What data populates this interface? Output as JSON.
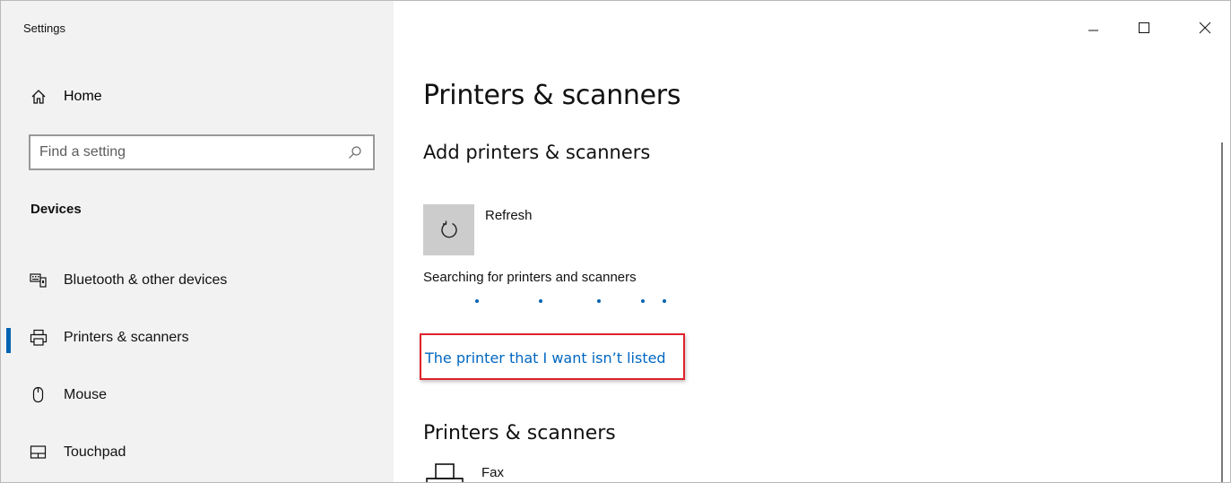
{
  "window": {
    "title": "Settings",
    "controls": {
      "minimize": "–",
      "maximize": "☐",
      "close": "✕"
    }
  },
  "sidebar": {
    "home_label": "Home",
    "search": {
      "placeholder": "Find a setting",
      "value": ""
    },
    "section_label": "Devices",
    "items": [
      {
        "label": "Bluetooth & other devices",
        "icon": "bluetooth-devices-icon",
        "selected": false
      },
      {
        "label": "Printers & scanners",
        "icon": "printer-icon",
        "selected": true
      },
      {
        "label": "Mouse",
        "icon": "mouse-icon",
        "selected": false
      },
      {
        "label": "Touchpad",
        "icon": "touchpad-icon",
        "selected": false
      }
    ]
  },
  "main": {
    "title": "Printers & scanners",
    "add_section": {
      "heading": "Add printers & scanners",
      "refresh_label": "Refresh",
      "status_text": "Searching for printers and scanners",
      "not_listed_link": "The printer that I want isn’t listed"
    },
    "printers_section": {
      "heading": "Printers & scanners",
      "devices": [
        {
          "label": "Fax",
          "icon": "fax-icon"
        }
      ]
    }
  },
  "colors": {
    "accent": "#0063b1",
    "link": "#0067c0",
    "highlight_box": "#e0212b",
    "sidebar_bg": "#f2f2f2"
  }
}
